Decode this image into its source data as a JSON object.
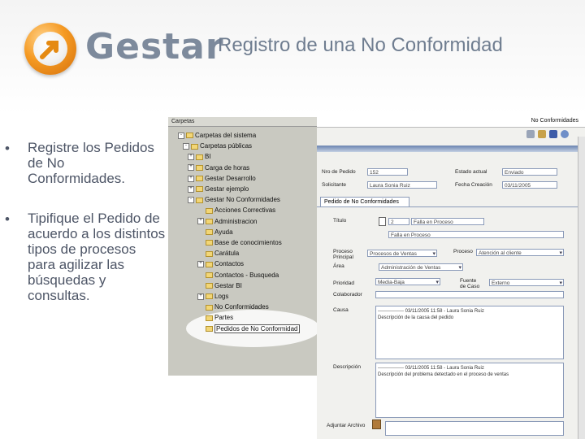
{
  "logo": {
    "text": "Gestar"
  },
  "slide": {
    "title": "Registro de una No Conformidad",
    "bullets": [
      {
        "mark": "•",
        "text": "Registre los Pedidos de No Conformidades."
      },
      {
        "mark": "•",
        "text": "Tipifique el Pedido de acuerdo a los distintos tipos de procesos para agilizar las búsquedas y consultas."
      }
    ]
  },
  "tree": {
    "header": "Carpetas",
    "items": [
      {
        "label": "Carpetas del sistema",
        "expander": "-"
      },
      {
        "label": "Carpetas públicas",
        "expander": "-"
      },
      {
        "label": "BI",
        "expander": "+"
      },
      {
        "label": "Carga de horas",
        "expander": "+"
      },
      {
        "label": "Gestar Desarrollo",
        "expander": "+"
      },
      {
        "label": "Gestar ejemplo",
        "expander": "+"
      },
      {
        "label": "Gestar No Conformidades",
        "expander": "-"
      },
      {
        "label": "Acciones Correctivas",
        "expander": ""
      },
      {
        "label": "Administracion",
        "expander": "+"
      },
      {
        "label": "Ayuda",
        "expander": ""
      },
      {
        "label": "Base de conocimientos",
        "expander": ""
      },
      {
        "label": "Carátula",
        "expander": ""
      },
      {
        "label": "Contactos",
        "expander": "+"
      },
      {
        "label": "Contactos - Busqueda",
        "expander": ""
      },
      {
        "label": "Gestar BI",
        "expander": ""
      },
      {
        "label": "Logs",
        "expander": "+"
      },
      {
        "label": "No Conformidades",
        "expander": ""
      },
      {
        "label": "Partes",
        "expander": ""
      },
      {
        "label": "Pedidos de No Conformidad",
        "expander": ""
      }
    ]
  },
  "form": {
    "window_title": "No Conformidades",
    "nro_label": "Nro de Pedido",
    "nro_value": "152",
    "estado_label": "Estado actual",
    "estado_value": "Enviado",
    "solicitante_label": "Solicitante",
    "solicitante_value": "Laura Sonia Ruiz",
    "fecha_label": "Fecha Creación",
    "fecha_value": "03/11/2005",
    "tab_label": "Pedido de No Conformidades",
    "titulo_label": "Título",
    "titulo_code": "2",
    "titulo_value1": "Falla en Proceso",
    "titulo_value2": "Falla en Proceso",
    "proceso_label": "Proceso Principal",
    "proceso_value": "Procesos de Ventas",
    "subproceso_label": "Proceso",
    "subproceso_value": "Atención al cliente",
    "area_label": "Área",
    "area_value": "Administración de Ventas",
    "prioridad_label": "Prioridad",
    "prioridad_value": "Media-Baja",
    "fuente_label": "Fuente de Caso",
    "fuente_value": "Externo",
    "colaborador_label": "Colaborador",
    "causa_label": "Causa",
    "causa_log": "---------------- 03/11/2005 11:58 - Laura Sonia Ruiz",
    "causa_text": "Descripción de la causa del pedido",
    "desc_label": "Descripción",
    "desc_log": "---------------- 03/11/2005 11:58 - Laura Sonia Ruiz",
    "desc_text": "Descripción del problema detectado en el proceso de ventas",
    "adjuntar_label": "Adjuntar Archivo"
  }
}
